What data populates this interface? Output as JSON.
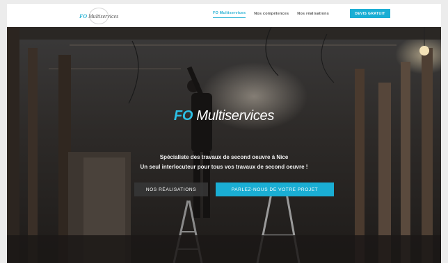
{
  "header": {
    "logo": {
      "fo": "FO",
      "name": "Multiservices"
    },
    "nav": [
      {
        "label": "FO Multiservices"
      },
      {
        "label": "Nos compétences"
      },
      {
        "label": "Nos réalisations"
      }
    ],
    "cta_label": "DEVIS GRATUIT"
  },
  "hero": {
    "brand_fo": "FO",
    "brand_name": "Multiservices",
    "tagline_1": "Spécialiste des travaux de second oeuvre à Nice",
    "tagline_2": "Un seul interlocuteur pour tous vos travaux de second oeuvre !",
    "button_realisations": "NOS RÉALISATIONS",
    "button_projet": "PARLEZ-NOUS DE VOTRE PROJET"
  },
  "colors": {
    "accent": "#1aaed4",
    "brand_blue": "#2cc0e6",
    "dark_button": "#373737"
  }
}
